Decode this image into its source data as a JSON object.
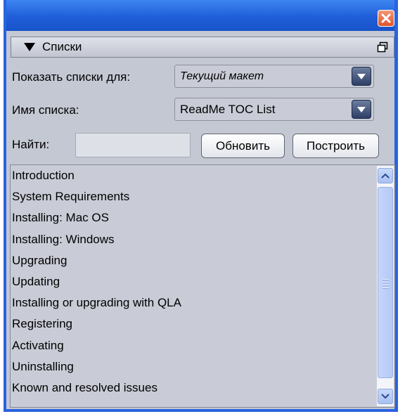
{
  "panel": {
    "title": "Списки"
  },
  "show_lists_for": {
    "label": "Показать списки для:",
    "value": "Текущий макет"
  },
  "list_name": {
    "label": "Имя списка:",
    "value": "ReadMe TOC List"
  },
  "find": {
    "label": "Найти:",
    "value": ""
  },
  "buttons": {
    "update": "Обновить",
    "build": "Построить"
  },
  "list_items": [
    "Introduction",
    "System Requirements",
    "Installing: Mac OS",
    "Installing: Windows",
    "Upgrading",
    "Updating",
    "Installing or upgrading with QLA",
    "Registering",
    "Activating",
    "Uninstalling",
    "Known and resolved issues"
  ],
  "icons": {
    "close": "close-icon",
    "collapse": "triangle-down-icon",
    "panel_menu": "panel-menu-icon",
    "dropdown": "chevron-down-icon",
    "scroll_up": "scroll-up-arrow-icon",
    "scroll_down": "scroll-down-arrow-icon"
  },
  "colors": {
    "title_bar": "#1f5ed8",
    "panel_bg": "#c4c8d2",
    "close_button": "#e0532c",
    "scrollbar": "#b5c9f5"
  }
}
